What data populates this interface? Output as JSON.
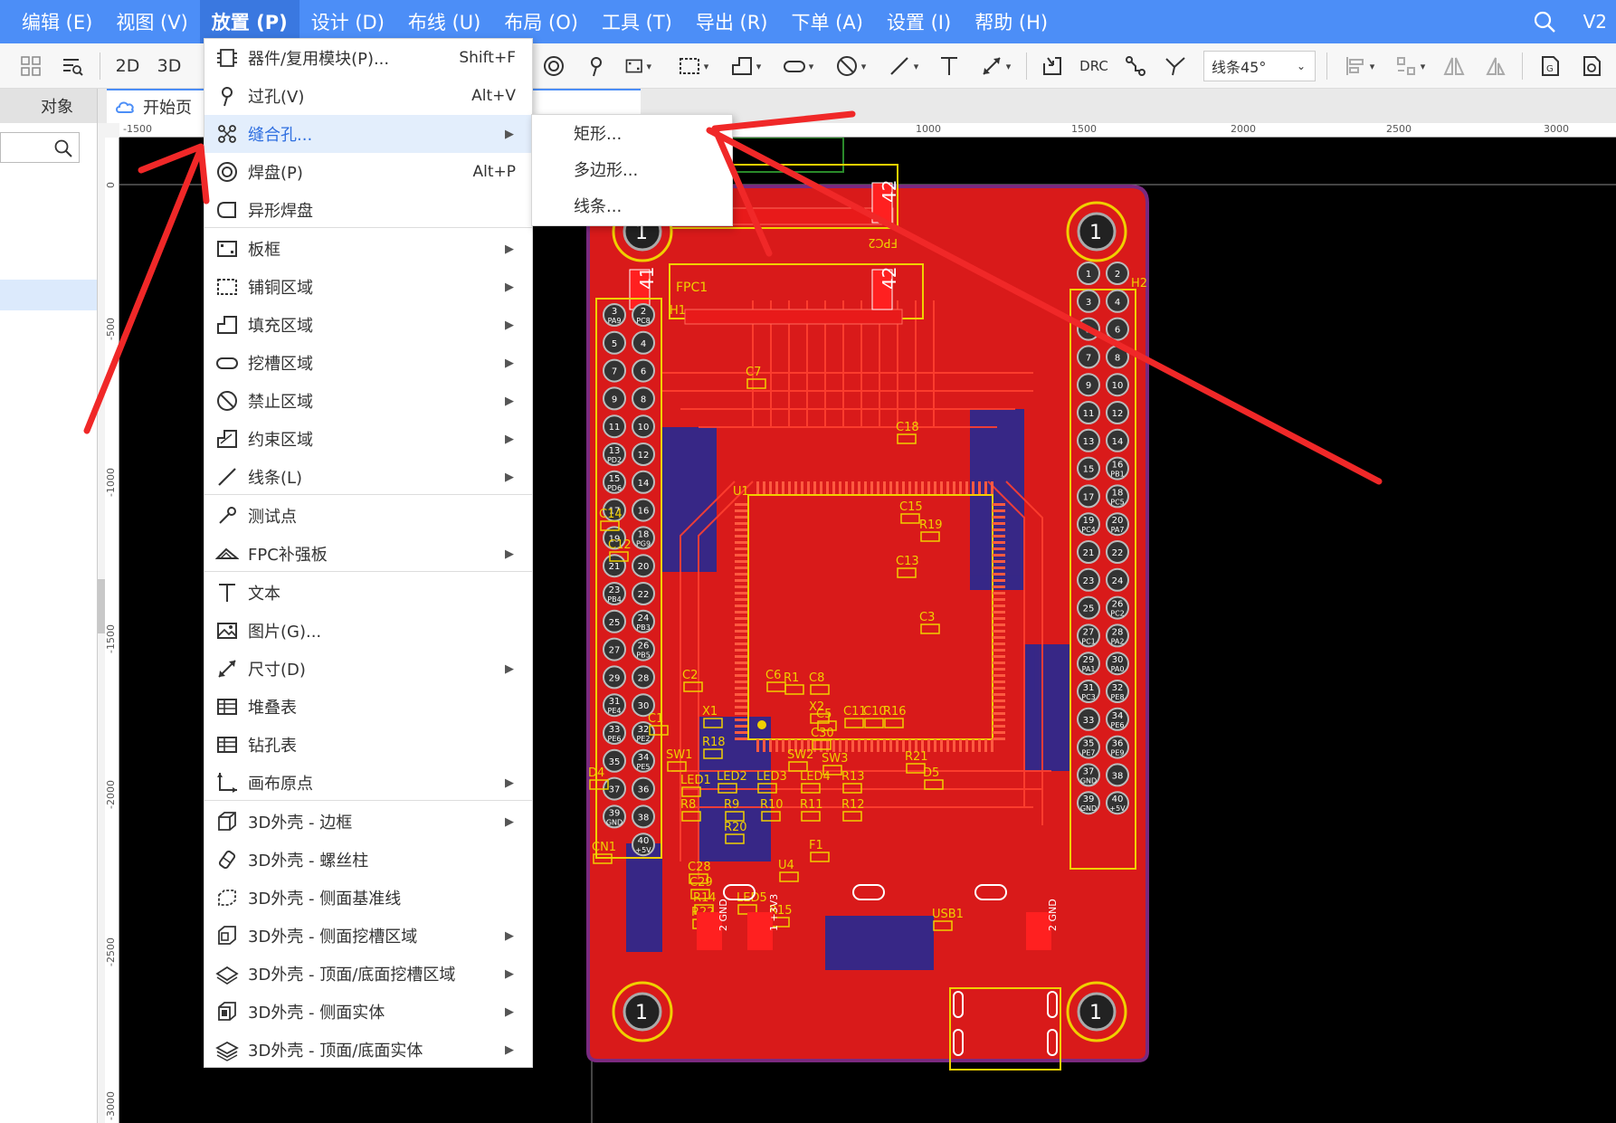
{
  "menubar": {
    "items": [
      "编辑 (E)",
      "视图 (V)",
      "放置 (P)",
      "设计 (D)",
      "布线 (U)",
      "布局 (O)",
      "工具 (T)",
      "导出 (R)",
      "下单 (A)",
      "设置 (I)",
      "帮助 (H)"
    ],
    "active_index": 2,
    "version": "V2"
  },
  "toolbar": {
    "btn_2d": "2D",
    "btn_3d": "3D",
    "btn_drc": "DRC",
    "line_mode": "线条45°"
  },
  "tabs": {
    "left_tab": "对象",
    "doc_tab": "开始页"
  },
  "ruler": {
    "h_labels": [
      "-1500",
      "1000",
      "1500",
      "2000",
      "2500",
      "3000"
    ],
    "v_labels": [
      "0",
      "-500",
      "-1000",
      "-1500",
      "-2000",
      "-2500",
      "-3000"
    ]
  },
  "place_menu": {
    "items": [
      {
        "label": "器件/复用模块(P)...",
        "shortcut": "Shift+F",
        "icon": "component-icon"
      },
      {
        "label": "过孔(V)",
        "shortcut": "Alt+V",
        "icon": "via-icon"
      },
      {
        "label": "缝合孔...",
        "submenu": true,
        "icon": "stitching-via-icon",
        "highlighted": true
      },
      {
        "label": "焊盘(P)",
        "shortcut": "Alt+P",
        "icon": "pad-icon"
      },
      {
        "label": "异形焊盘",
        "icon": "custom-pad-icon"
      },
      {
        "label": "板框",
        "submenu": true,
        "icon": "board-outline-icon"
      },
      {
        "label": "铺铜区域",
        "submenu": true,
        "icon": "copper-area-icon"
      },
      {
        "label": "填充区域",
        "submenu": true,
        "icon": "fill-area-icon"
      },
      {
        "label": "挖槽区域",
        "submenu": true,
        "icon": "slot-area-icon"
      },
      {
        "label": "禁止区域",
        "submenu": true,
        "icon": "prohibited-area-icon"
      },
      {
        "label": "约束区域",
        "submenu": true,
        "icon": "constraint-area-icon"
      },
      {
        "label": "线条(L)",
        "submenu": true,
        "icon": "line-icon"
      },
      {
        "label": "测试点",
        "icon": "test-point-icon"
      },
      {
        "label": "FPC补强板",
        "submenu": true,
        "icon": "fpc-stiffener-icon"
      },
      {
        "label": "文本",
        "icon": "text-icon"
      },
      {
        "label": "图片(G)...",
        "icon": "image-icon"
      },
      {
        "label": "尺寸(D)",
        "submenu": true,
        "icon": "dimension-icon"
      },
      {
        "label": "堆叠表",
        "icon": "stackup-table-icon"
      },
      {
        "label": "钻孔表",
        "icon": "drill-table-icon"
      },
      {
        "label": "画布原点",
        "submenu": true,
        "icon": "canvas-origin-icon"
      },
      {
        "label": "3D外壳 - 边框",
        "submenu": true,
        "icon": "3d-shell-frame-icon"
      },
      {
        "label": "3D外壳 - 螺丝柱",
        "icon": "3d-screw-post-icon"
      },
      {
        "label": "3D外壳 - 侧面基准线",
        "icon": "3d-side-datum-icon"
      },
      {
        "label": "3D外壳 - 侧面挖槽区域",
        "submenu": true,
        "icon": "3d-side-slot-icon"
      },
      {
        "label": "3D外壳 - 顶面/底面挖槽区域",
        "submenu": true,
        "icon": "3d-top-slot-icon"
      },
      {
        "label": "3D外壳 - 侧面实体",
        "submenu": true,
        "icon": "3d-side-solid-icon"
      },
      {
        "label": "3D外壳 - 顶面/底面实体",
        "submenu": true,
        "icon": "3d-top-solid-icon"
      }
    ]
  },
  "stitching_submenu": {
    "items": [
      "矩形...",
      "多边形...",
      "线条..."
    ]
  },
  "pcb": {
    "mount_hole_label": "1",
    "designators": [
      "FPC1",
      "FPC2",
      "H1",
      "H2",
      "C7",
      "U1",
      "C14",
      "C12",
      "C15",
      "R19",
      "C13",
      "C3",
      "C18",
      "X1",
      "X2",
      "C2",
      "C6",
      "R1",
      "C8",
      "C1",
      "C11",
      "C10",
      "R16",
      "C5",
      "C30",
      "SW1",
      "SW2",
      "SW3",
      "R18",
      "R21",
      "D4",
      "D5",
      "LED1",
      "LED2",
      "LED3",
      "LED4",
      "R13",
      "R8",
      "R9",
      "R10",
      "R11",
      "R12",
      "R20",
      "CN1",
      "C28",
      "C29",
      "R14",
      "R22",
      "LED5",
      "R15",
      "U4",
      "F1",
      "USB1"
    ],
    "connector_numbers": [
      "41",
      "42",
      "4",
      "41",
      "42"
    ],
    "h1_pins_left": [
      "3 PA9",
      "5",
      "7",
      "9",
      "11",
      "13 PD2",
      "15 PD6",
      "17",
      "19",
      "21",
      "23 PB4",
      "25",
      "27",
      "29",
      "31 PE4",
      "33 PE6",
      "35",
      "37",
      "39 GND"
    ],
    "h1_pins_right": [
      "2 PC8",
      "4",
      "6",
      "8",
      "10",
      "12",
      "14",
      "16",
      "18 PG9",
      "20",
      "22",
      "24 PB3",
      "26 PB5",
      "28",
      "30",
      "32 PE2",
      "34 PE5",
      "36",
      "38",
      "40 +5V"
    ],
    "h2_pins_left": [
      "1",
      "3",
      "5",
      "7",
      "9",
      "11",
      "13",
      "15",
      "17",
      "19 PC4",
      "21",
      "23",
      "25",
      "27 PC1",
      "29 PA1",
      "31 PC3",
      "33",
      "35 PE7",
      "37 GND",
      "39 GND"
    ],
    "h2_pins_right": [
      "2",
      "4",
      "6",
      "8",
      "10",
      "12",
      "14",
      "16 PB1",
      "18 PC5",
      "20 PA7",
      "22",
      "24",
      "26 PC2",
      "28 PA2",
      "30 PA0",
      "32 PE8",
      "34 PE6",
      "36 PE9",
      "38",
      "40 +5V"
    ],
    "gnd_label": "2 GND",
    "v3_label": "1 +3V3",
    "colors": {
      "board": "#d91a1a",
      "board_edge": "#e0c000",
      "bottom_layer": "#1a2a9a",
      "silk": "#f0d000",
      "background": "#000000"
    }
  }
}
